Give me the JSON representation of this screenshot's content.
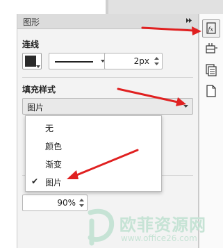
{
  "panel": {
    "title": "图形"
  },
  "line": {
    "section_label": "连线",
    "color": "#2a2a2a",
    "width_value": "2px"
  },
  "fill": {
    "section_label": "填充样式",
    "selected": "图片",
    "options": [
      "无",
      "颜色",
      "渐变",
      "图片"
    ],
    "checked_index": 3
  },
  "opacity": {
    "value": "90%"
  },
  "toolbar": {
    "icons": [
      "formula-icon",
      "insert-row-icon",
      "copy-pages-icon",
      "document-icon"
    ]
  },
  "watermark": {
    "name": "欧菲资源网",
    "url": "www.office26.com"
  },
  "colors": {
    "annotation_arrow": "#e02020",
    "watermark": "#c6e3d5"
  }
}
